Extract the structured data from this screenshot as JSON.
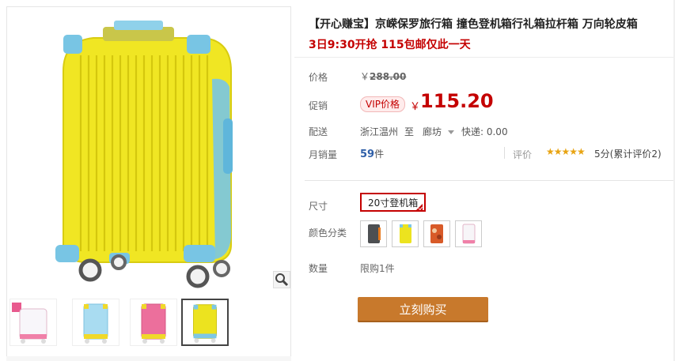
{
  "product": {
    "title": "【开心赚宝】京嵘保罗旅行箱 撞色登机箱行礼箱拉杆箱 万向轮皮箱",
    "promo": "3日9:30开抢 115包邮仅此一天"
  },
  "price": {
    "label": "价格",
    "currency": "￥",
    "original": "288.00"
  },
  "promotion": {
    "label": "促销",
    "tag": "VIP价格",
    "currency": "￥",
    "price": "115.20"
  },
  "shipping": {
    "label": "配送",
    "from": "浙江温州",
    "to_word": "至",
    "destination": "廊坊",
    "express": "快递: 0.00"
  },
  "sales": {
    "label": "月销量",
    "count": "59",
    "unit": "件",
    "rating_label": "评价",
    "stars": "★★★★★",
    "rating_text": "5分(累计评价2)"
  },
  "size": {
    "label": "尺寸",
    "selected": "20寸登机箱"
  },
  "color": {
    "label": "颜色分类",
    "options": [
      "dark-grey",
      "yellow",
      "orange-pattern",
      "white-pink"
    ]
  },
  "quantity": {
    "label": "数量",
    "limit": "限购1件"
  },
  "buy_button": "立刻购买",
  "colors": {
    "brand_red": "#c40000",
    "buy_orange": "#c8792c",
    "sales_blue": "#2f5fa8"
  }
}
